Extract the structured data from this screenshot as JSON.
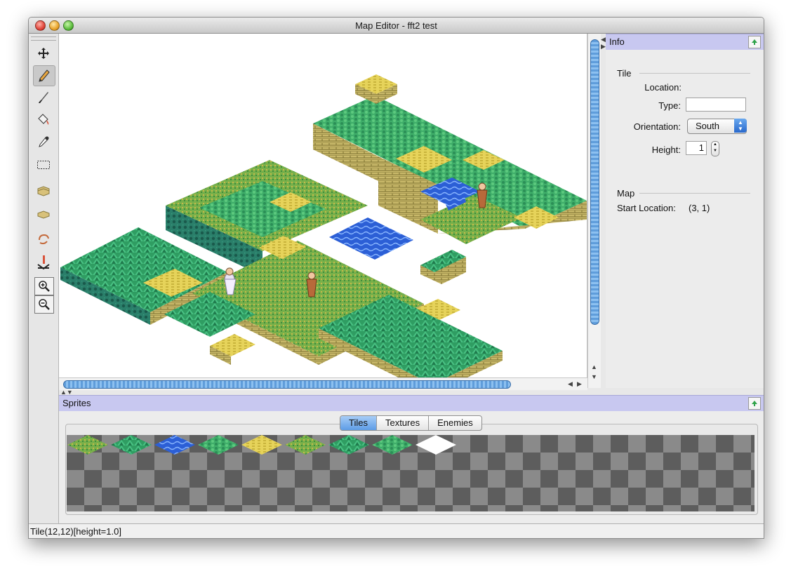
{
  "window": {
    "title": "Map Editor - fft2 test"
  },
  "toolbar": {
    "tools": [
      {
        "name": "move",
        "icon": "move-arrows-icon"
      },
      {
        "name": "pencil",
        "icon": "pencil-icon",
        "active": true
      },
      {
        "name": "brush",
        "icon": "brush-icon"
      },
      {
        "name": "fill",
        "icon": "paint-bucket-icon"
      },
      {
        "name": "eyedropper",
        "icon": "eyedropper-icon"
      },
      {
        "name": "select",
        "icon": "marquee-select-icon"
      },
      {
        "name": "raise",
        "icon": "raise-tile-icon"
      },
      {
        "name": "lower",
        "icon": "lower-tile-icon"
      },
      {
        "name": "rotate",
        "icon": "rotate-icon"
      },
      {
        "name": "start-location",
        "icon": "start-location-icon"
      },
      {
        "name": "zoom-in",
        "icon": "zoom-in-icon"
      },
      {
        "name": "zoom-out",
        "icon": "zoom-out-icon"
      }
    ]
  },
  "info": {
    "header": "Info",
    "tile_group": "Tile",
    "location_label": "Location:",
    "type_label": "Type:",
    "type_value": "",
    "orientation_label": "Orientation:",
    "orientation_value": "South",
    "height_label": "Height:",
    "height_value": "1",
    "map_group": "Map",
    "start_location_label": "Start Location:",
    "start_location_value": "(3, 1)"
  },
  "sprites": {
    "header": "Sprites",
    "tabs": [
      "Tiles",
      "Textures",
      "Enemies"
    ],
    "selected_tab": "Tiles",
    "palette": [
      "grass-tile",
      "fern-tile",
      "water-tile",
      "leafy-tile",
      "sand-tile",
      "moss-tile",
      "bush-tile",
      "clover-tile",
      "blank-tile"
    ]
  },
  "status": {
    "text": "Tile(12,12)[height=1.0]"
  },
  "colors": {
    "grass": "#3fae6a",
    "grass_dark": "#1f7a4c",
    "sand": "#e6d35a",
    "water": "#2c5fd6",
    "cliff": "#c9b96a",
    "panel_header": "#c8c8f0",
    "scroll_blue": "#5f9ddb"
  }
}
